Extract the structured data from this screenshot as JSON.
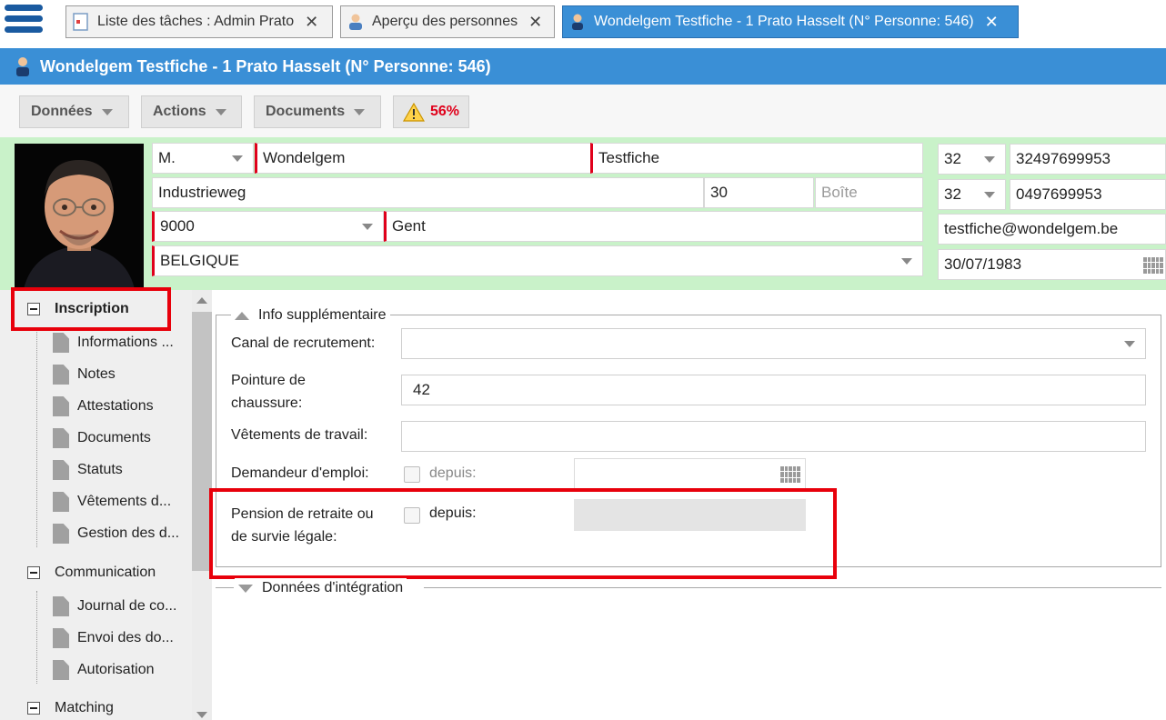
{
  "tabs": [
    {
      "label": "Liste des tâches : Admin Prato",
      "icon": "task-list-icon",
      "active": false
    },
    {
      "label": "Aperçu des personnes",
      "icon": "person-icon",
      "active": false
    },
    {
      "label": "Wondelgem Testfiche - 1 Prato Hasselt (N° Personne: 546)",
      "icon": "person-icon",
      "active": true
    }
  ],
  "header": {
    "title": "Wondelgem Testfiche - 1 Prato Hasselt (N° Personne: 546)",
    "icon": "person-icon"
  },
  "toolbar": {
    "data_label": "Données",
    "actions_label": "Actions",
    "documents_label": "Documents",
    "completion": "56%",
    "completion_icon": "warning-icon"
  },
  "person": {
    "title": "M.",
    "last_name": "Wondelgem",
    "first_name": "Testfiche",
    "street": "Industrieweg",
    "number": "30",
    "box_placeholder": "Boîte",
    "postal_code": "9000",
    "city": "Gent",
    "country": "BELGIQUE",
    "phone1_prefix": "32",
    "phone1": "32497699953",
    "phone2_prefix": "32",
    "phone2": "0497699953",
    "email": "testfiche@wondelgem.be",
    "birth_date": "30/07/1983"
  },
  "nav": {
    "sections": [
      {
        "label": "Inscription",
        "bold": true,
        "items": [
          "Informations ...",
          "Notes",
          "Attestations",
          "Documents",
          "Statuts",
          "Vêtements d...",
          "Gestion des d..."
        ]
      },
      {
        "label": "Communication",
        "bold": false,
        "items": [
          "Journal de co...",
          "Envoi des do...",
          "Autorisation"
        ]
      },
      {
        "label": "Matching",
        "bold": false,
        "items": []
      }
    ]
  },
  "form": {
    "legend": "Info supplémentaire",
    "canal_label": "Canal de recrutement:",
    "canal_value": "",
    "shoe_label_1": "Pointure de",
    "shoe_label_2": "chaussure:",
    "shoe_value": "42",
    "workwear_label": "Vêtements de travail:",
    "workwear_value": "",
    "jobseeker_label": "Demandeur d'emploi:",
    "jobseeker_since": "depuis:",
    "pension_label_1": "Pension de retraite ou",
    "pension_label_2": "de survie légale:",
    "pension_since": "depuis:",
    "integration_legend": "Données d'intégration"
  },
  "colors": {
    "accent": "#3a8fd6",
    "required": "#e0001b",
    "person_bg": "#c9f2c9",
    "highlight": "#e8000b"
  }
}
